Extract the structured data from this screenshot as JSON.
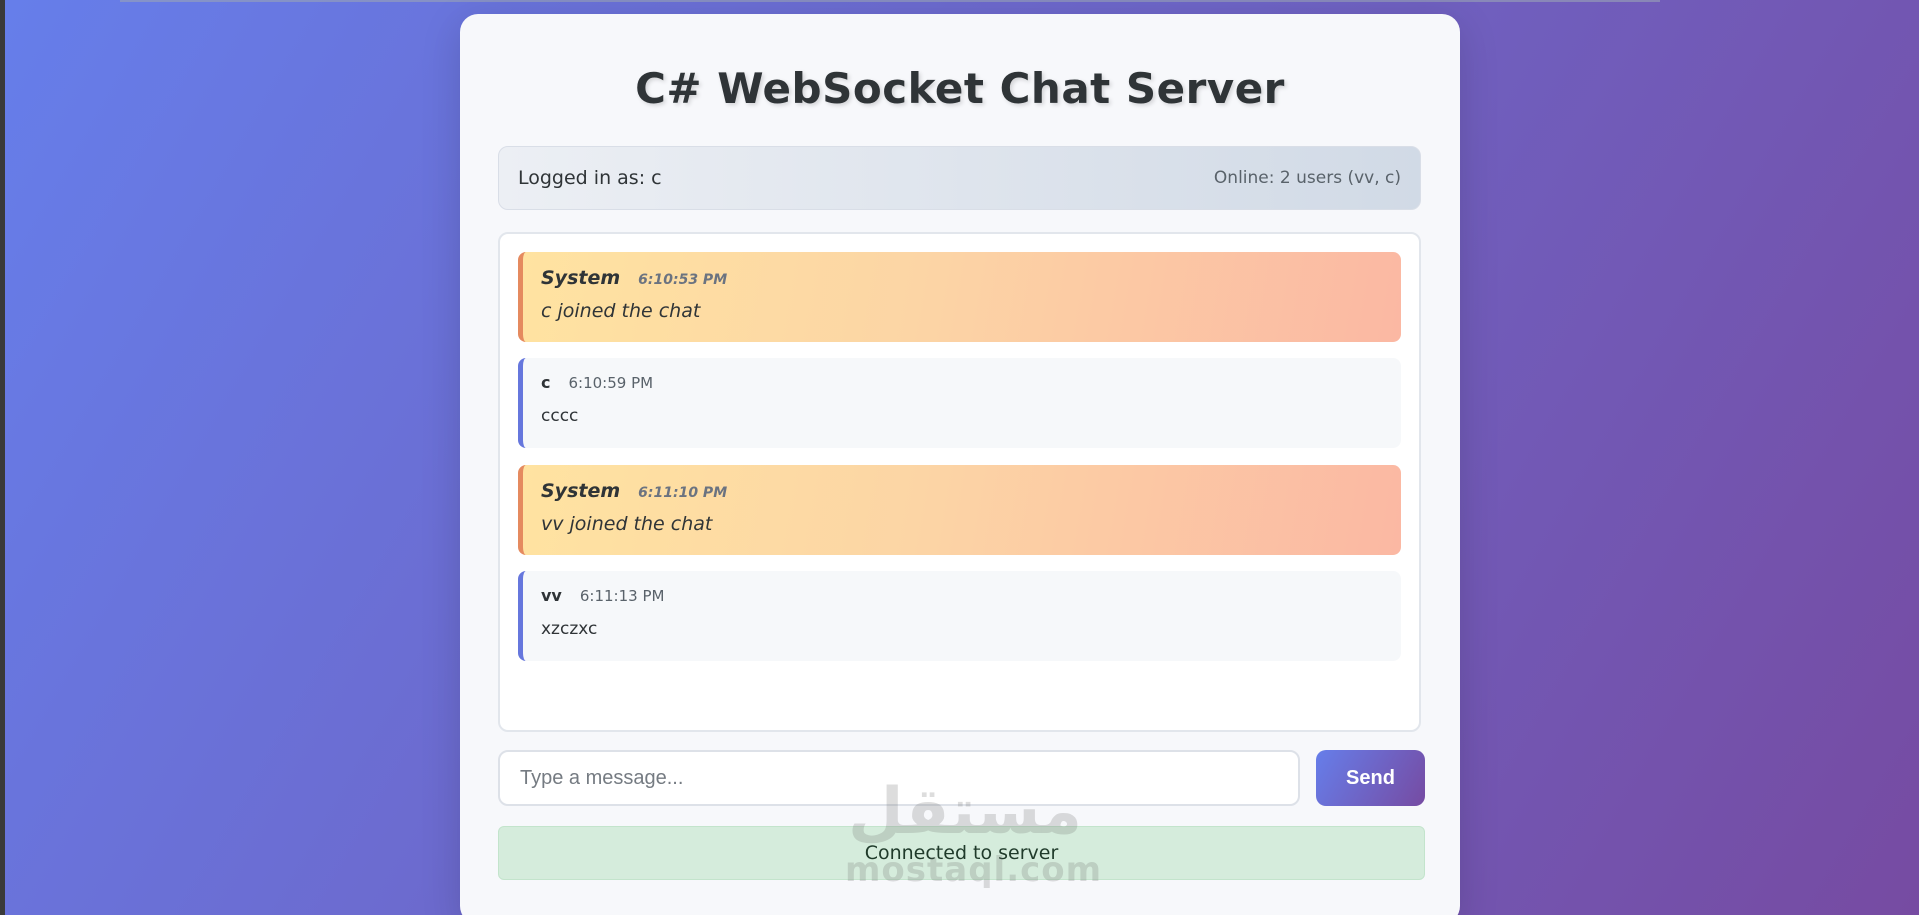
{
  "app": {
    "title": "C# WebSocket Chat Server"
  },
  "userbar": {
    "logged_in": "Logged in as: c",
    "online": "Online: 2 users (vv, c)"
  },
  "messages": [
    {
      "type": "system",
      "author": "System",
      "time": "6:10:53 PM",
      "text": "c joined the chat"
    },
    {
      "type": "user",
      "author": "c",
      "time": "6:10:59 PM",
      "text": "cccc"
    },
    {
      "type": "system",
      "author": "System",
      "time": "6:11:10 PM",
      "text": "vv joined the chat"
    },
    {
      "type": "user",
      "author": "vv",
      "time": "6:11:13 PM",
      "text": "xzczxc"
    }
  ],
  "composer": {
    "placeholder": "Type a message...",
    "value": "",
    "send_label": "Send"
  },
  "status": {
    "text": "Connected to server"
  },
  "watermark": {
    "arabic": "مستقل",
    "latin": "mostaql.com"
  },
  "colors": {
    "gradient_start": "#667eea",
    "gradient_end": "#764ba2",
    "system_border": "#e58a5f",
    "user_border": "#6677dd",
    "status_bg": "#d5ecdc"
  }
}
